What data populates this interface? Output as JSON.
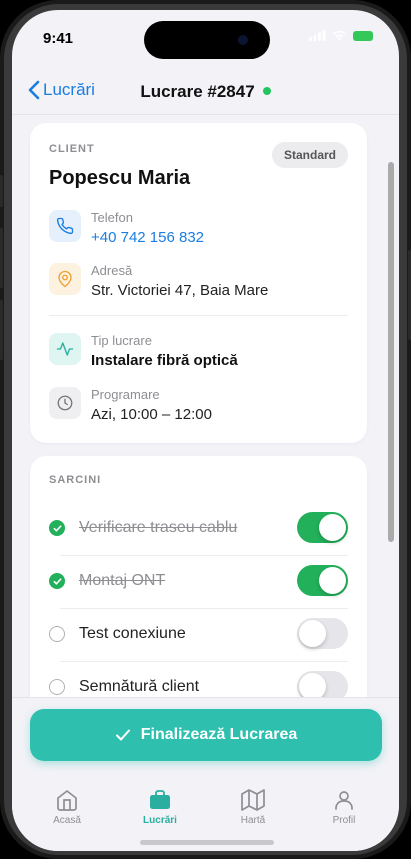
{
  "status_bar": {
    "time": "9:41"
  },
  "nav": {
    "back_label": "Lucrări",
    "title": "Lucrare #2847"
  },
  "client_card": {
    "section_label": "CLIENT",
    "badge": "Standard",
    "name": "Popescu Maria",
    "phone": {
      "label": "Telefon",
      "value": "+40 742 156 832",
      "icon": "phone-icon"
    },
    "address": {
      "label": "Adresă",
      "value": "Str. Victoriei 47, Baia Mare",
      "icon": "map-pin-icon"
    },
    "work_type": {
      "label": "Tip lucrare",
      "value": "Instalare fibră optică",
      "icon": "activity-icon"
    },
    "schedule": {
      "label": "Programare",
      "value": "Azi, 10:00 – 12:00",
      "icon": "clock-icon"
    }
  },
  "tasks_card": {
    "section_label": "SARCINI",
    "tasks": [
      {
        "label": "Verificare traseu cablu",
        "done": true
      },
      {
        "label": "Montaj ONT",
        "done": true
      },
      {
        "label": "Test conexiune",
        "done": false
      },
      {
        "label": "Semnătură client",
        "done": false
      }
    ]
  },
  "cta": {
    "label": "Finalizează Lucrarea"
  },
  "tabbar": {
    "tabs": [
      {
        "label": "Acasă",
        "icon": "home-icon",
        "active": false
      },
      {
        "label": "Lucrări",
        "icon": "briefcase-icon",
        "active": true
      },
      {
        "label": "Hartă",
        "icon": "map-icon",
        "active": false
      },
      {
        "label": "Profil",
        "icon": "user-icon",
        "active": false
      }
    ]
  },
  "colors": {
    "accent": "#2fbfae",
    "link": "#1a7de0",
    "success": "#22b05a",
    "status_dot": "#22c55e"
  }
}
